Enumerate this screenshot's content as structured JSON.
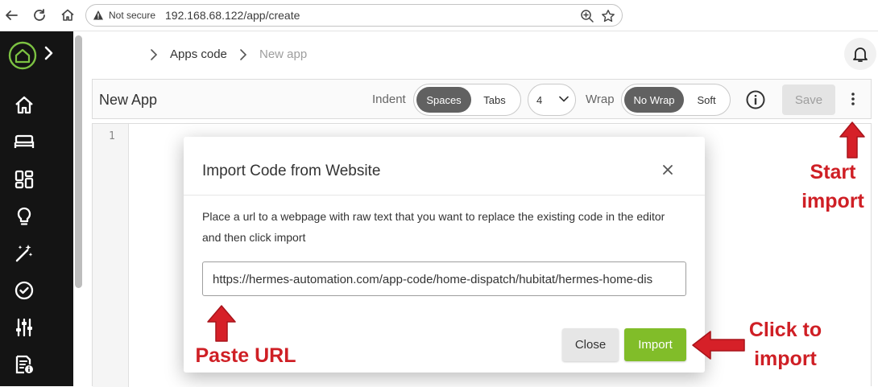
{
  "browser": {
    "security_label": "Not secure",
    "url": "192.168.68.122/app/create"
  },
  "breadcrumb": {
    "items": [
      "Apps code",
      "New app"
    ]
  },
  "toolbar": {
    "title": "New App",
    "indent_label": "Indent",
    "indent_options": [
      "Spaces",
      "Tabs"
    ],
    "indent_selected": "Spaces",
    "indent_size": "4",
    "wrap_label": "Wrap",
    "wrap_options": [
      "No Wrap",
      "Soft"
    ],
    "wrap_selected": "No Wrap",
    "save_label": "Save"
  },
  "editor": {
    "line_numbers": [
      "1"
    ]
  },
  "modal": {
    "title": "Import Code from Website",
    "body": "Place a url to a webpage with raw text that you want to replace the existing code in the editor and then click import",
    "input_value": "https://hermes-automation.com/app-code/home-dispatch/hubitat/hermes-home-dis",
    "close_label": "Close",
    "import_label": "Import"
  },
  "annotations": {
    "start_import": "Start import",
    "paste_url": "Paste URL",
    "click_to_import": "Click to import"
  },
  "colors": {
    "sidebar_bg": "#141414",
    "accent_green": "#81bd29",
    "annotation_red": "#cf1f25",
    "segment_active": "#616161"
  }
}
